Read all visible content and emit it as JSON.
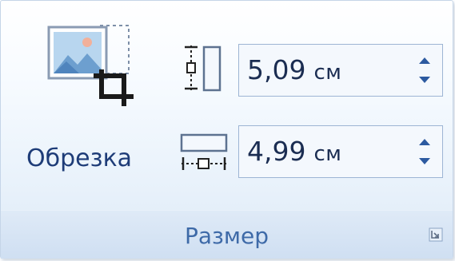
{
  "group": {
    "label": "Размер",
    "launcher_icon": "dialog-launcher-icon"
  },
  "crop": {
    "label": "Обрезка",
    "icon": "crop-picture-icon"
  },
  "height": {
    "value": "5,09",
    "unit": "см",
    "icon": "shape-height-icon"
  },
  "width": {
    "value": "4,99",
    "unit": "см",
    "icon": "shape-width-icon"
  },
  "colors": {
    "label_blue": "#1e3c78",
    "group_label_blue": "#3e6aa8",
    "arrow_blue": "#2c5aa0",
    "field_border": "#9db5d4"
  }
}
